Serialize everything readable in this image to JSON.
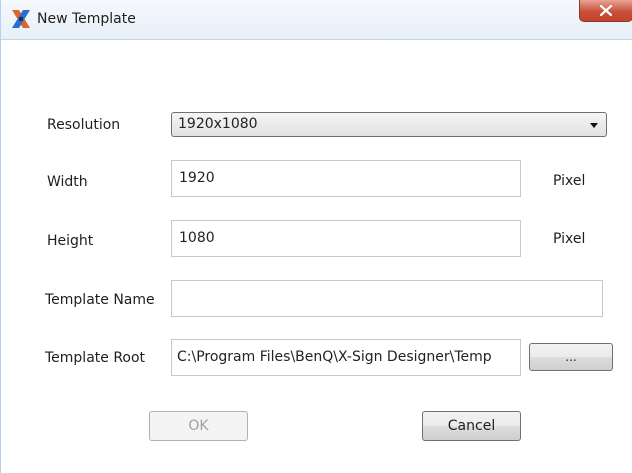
{
  "window": {
    "title": "New Template",
    "icon": "x-sign-app-icon",
    "close_glyph": "X"
  },
  "form": {
    "resolution": {
      "label": "Resolution",
      "selected": "1920x1080"
    },
    "width": {
      "label": "Width",
      "value": "1920",
      "unit": "Pixel"
    },
    "height": {
      "label": "Height",
      "value": "1080",
      "unit": "Pixel"
    },
    "template_name": {
      "label": "Template Name",
      "value": ""
    },
    "template_root": {
      "label": "Template Root",
      "value": "C:\\Program Files\\BenQ\\X-Sign Designer\\Temp",
      "browse_label": "..."
    }
  },
  "buttons": {
    "ok_label": "OK",
    "cancel_label": "Cancel"
  },
  "colors": {
    "titlebar": "#e7eff8",
    "close_button": "#c9503a",
    "disabled_text": "#a0a0a0"
  }
}
